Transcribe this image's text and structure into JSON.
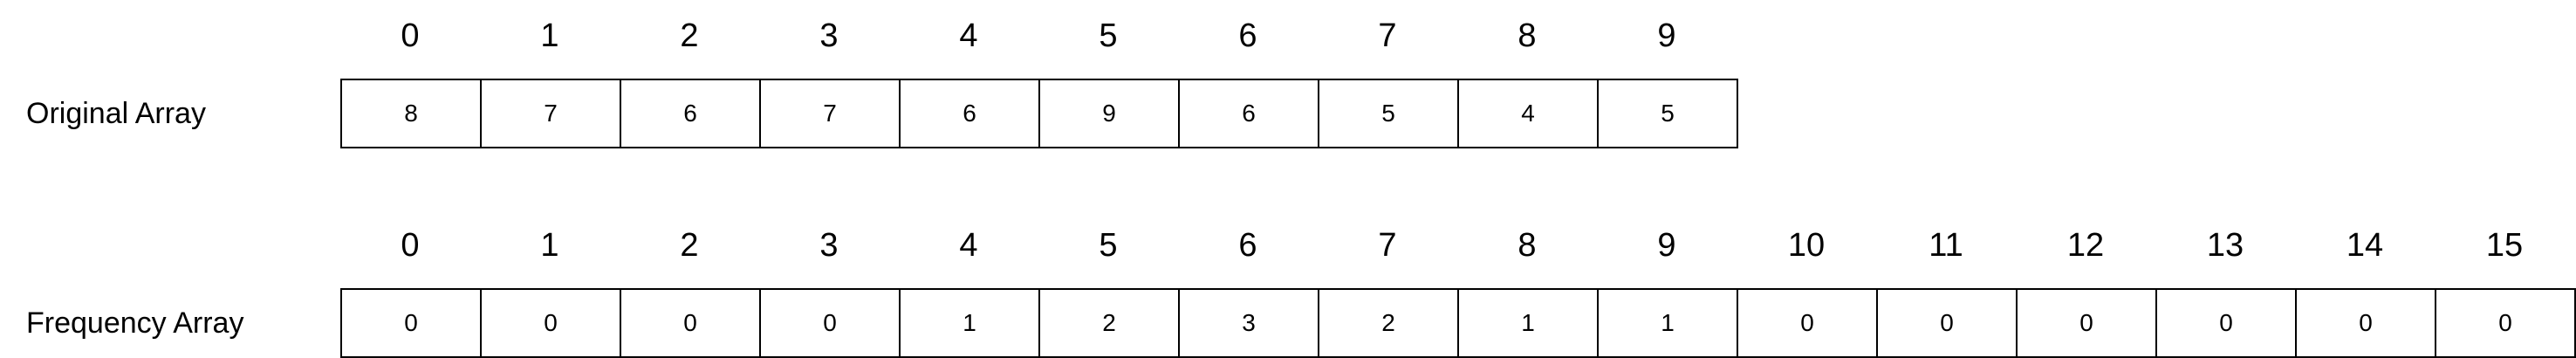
{
  "original": {
    "label": "Original Array",
    "indices": [
      "0",
      "1",
      "2",
      "3",
      "4",
      "5",
      "6",
      "7",
      "8",
      "9"
    ],
    "values": [
      "8",
      "7",
      "6",
      "7",
      "6",
      "9",
      "6",
      "5",
      "4",
      "5"
    ]
  },
  "frequency": {
    "label": "Frequency Array",
    "indices": [
      "0",
      "1",
      "2",
      "3",
      "4",
      "5",
      "6",
      "7",
      "8",
      "9",
      "10",
      "11",
      "12",
      "13",
      "14",
      "15"
    ],
    "values": [
      "0",
      "0",
      "0",
      "0",
      "1",
      "2",
      "3",
      "2",
      "1",
      "1",
      "0",
      "0",
      "0",
      "0",
      "0",
      "0"
    ]
  }
}
